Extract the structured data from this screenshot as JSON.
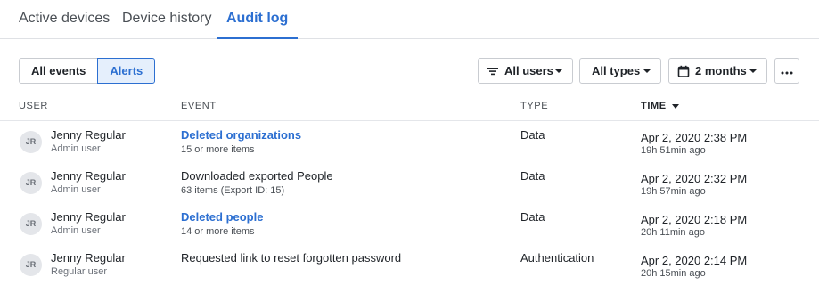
{
  "tabs": [
    {
      "label": "Active devices"
    },
    {
      "label": "Device history"
    },
    {
      "label": "Audit log"
    }
  ],
  "view_toggle": {
    "all_events": "All events",
    "alerts": "Alerts",
    "selected": "Alerts"
  },
  "filters": {
    "users": {
      "label": "All users",
      "icon": "filter-lines-icon"
    },
    "types": {
      "label": "All types"
    },
    "range": {
      "label": "2 months",
      "icon": "calendar-icon"
    },
    "more_icon": "ellipsis-icon"
  },
  "table": {
    "columns": {
      "user": "USER",
      "event": "EVENT",
      "type": "TYPE",
      "time": "TIME"
    },
    "sort": {
      "column": "TIME",
      "direction": "descending"
    },
    "rows": [
      {
        "initials": "JR",
        "name": "Jenny Regular",
        "role": "Admin user",
        "event": "Deleted organizations",
        "event_detail": "15 or more items",
        "type": "Data",
        "time": "Apr 2, 2020 2:38 PM",
        "ago": "19h 51min ago"
      },
      {
        "initials": "JR",
        "name": "Jenny Regular",
        "role": "Admin user",
        "event": "Downloaded exported People",
        "event_detail": "63 items (Export ID: 15)",
        "type": "Data",
        "time": "Apr 2, 2020 2:32 PM",
        "ago": "19h 57min ago"
      },
      {
        "initials": "JR",
        "name": "Jenny Regular",
        "role": "Admin user",
        "event": "Deleted people",
        "event_detail": "14 or more items",
        "type": "Data",
        "time": "Apr 2, 2020 2:18 PM",
        "ago": "20h 11min ago"
      },
      {
        "initials": "JR",
        "name": "Jenny Regular",
        "role": "Regular user",
        "event": "Requested link to reset forgotten password",
        "event_detail": "",
        "type": "Authentication",
        "time": "Apr 2, 2020 2:14 PM",
        "ago": "20h 15min ago"
      }
    ]
  },
  "colors": {
    "accent": "#2c6fd1",
    "accent_bg": "#e5effc",
    "border": "#c9ccd1",
    "text": "#1f2328",
    "muted": "#6b7078"
  }
}
